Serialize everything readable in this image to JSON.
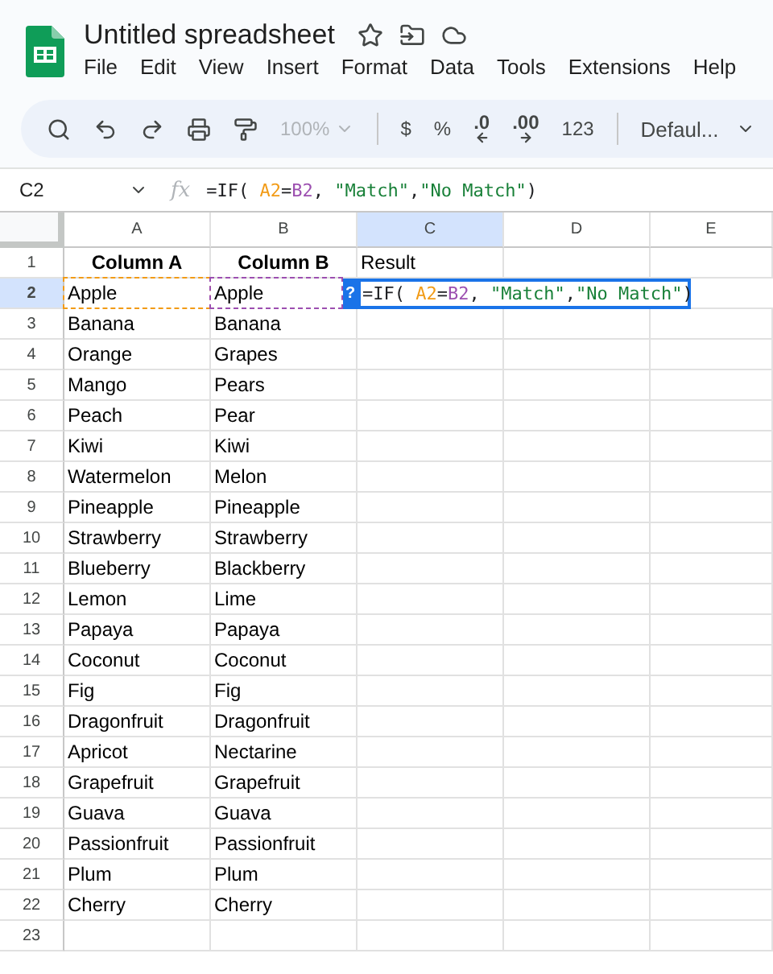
{
  "document": {
    "title": "Untitled spreadsheet"
  },
  "menu": [
    "File",
    "Edit",
    "View",
    "Insert",
    "Format",
    "Data",
    "Tools",
    "Extensions",
    "Help"
  ],
  "toolbar": [
    {
      "kind": "search"
    },
    {
      "kind": "undo"
    },
    {
      "kind": "redo"
    },
    {
      "kind": "print"
    },
    {
      "kind": "paint"
    },
    {
      "kind": "zoom",
      "label": "100%",
      "disabled": true
    },
    {
      "kind": "divider"
    },
    {
      "kind": "text",
      "label": "$"
    },
    {
      "kind": "text",
      "label": "%"
    },
    {
      "kind": "decimal_less",
      "label": ".0"
    },
    {
      "kind": "decimal_more",
      "label": ".00"
    },
    {
      "kind": "text",
      "label": "123"
    },
    {
      "kind": "divider"
    },
    {
      "kind": "font",
      "label": "Defaul..."
    }
  ],
  "formula_bar": {
    "cell_ref": "C2",
    "function_label": "fx",
    "tokens": [
      {
        "text": "=IF( ",
        "color": "#202124"
      },
      {
        "text": "A2",
        "color": "#f29b16"
      },
      {
        "text": "=",
        "color": "#202124"
      },
      {
        "text": "B2",
        "color": "#9c4fb0"
      },
      {
        "text": ", ",
        "color": "#202124"
      },
      {
        "text": "\"Match\"",
        "color": "#188038"
      },
      {
        "text": ",",
        "color": "#202124"
      },
      {
        "text": "\"No Match\"",
        "color": "#188038"
      },
      {
        "text": ")",
        "color": "#202124"
      }
    ]
  },
  "columns": [
    {
      "label": "A",
      "selected": false
    },
    {
      "label": "B",
      "selected": false
    },
    {
      "label": "C",
      "selected": true
    },
    {
      "label": "D",
      "selected": false
    },
    {
      "label": "E",
      "selected": false
    }
  ],
  "rows": [
    {
      "number": "1",
      "selected": false,
      "cells": [
        {
          "text": "Column A",
          "bold": true
        },
        {
          "text": "Column B",
          "bold": true
        },
        {
          "text": "Result",
          "bold": false
        }
      ]
    },
    {
      "number": "2",
      "selected": true,
      "cells": [
        {
          "text": "Apple",
          "color": "#f29b16"
        },
        {
          "text": "Apple",
          "color": "#9c4fb0"
        }
      ],
      "editor": {
        "help": "?",
        "tokens": [
          {
            "text": "=IF( ",
            "color": "#202124"
          },
          {
            "text": "A2",
            "color": "#f29b16"
          },
          {
            "text": "=",
            "color": "#202124"
          },
          {
            "text": "B2",
            "color": "#9c4fb0"
          },
          {
            "text": ", ",
            "color": "#202124"
          },
          {
            "text": "\"Match\"",
            "color": "#188038"
          },
          {
            "text": ",",
            "color": "#202124"
          },
          {
            "text": "\"No Match\"",
            "color": "#188038"
          },
          {
            "text": ")",
            "color": "#202124"
          }
        ]
      }
    },
    {
      "number": "3",
      "selected": false,
      "cells": [
        "Banana",
        "Banana"
      ]
    },
    {
      "number": "4",
      "selected": false,
      "cells": [
        "Orange",
        "Grapes"
      ]
    },
    {
      "number": "5",
      "selected": false,
      "cells": [
        "Mango",
        "Pears"
      ]
    },
    {
      "number": "6",
      "selected": false,
      "cells": [
        "Peach",
        "Pear"
      ]
    },
    {
      "number": "7",
      "selected": false,
      "cells": [
        "Kiwi",
        "Kiwi"
      ]
    },
    {
      "number": "8",
      "selected": false,
      "cells": [
        "Watermelon",
        "Melon"
      ]
    },
    {
      "number": "9",
      "selected": false,
      "cells": [
        "Pineapple",
        "Pineapple"
      ]
    },
    {
      "number": "10",
      "selected": false,
      "cells": [
        "Strawberry",
        "Strawberry"
      ]
    },
    {
      "number": "11",
      "selected": false,
      "cells": [
        "Blueberry",
        "Blackberry"
      ]
    },
    {
      "number": "12",
      "selected": false,
      "cells": [
        "Lemon",
        "Lime"
      ]
    },
    {
      "number": "13",
      "selected": false,
      "cells": [
        "Papaya",
        "Papaya"
      ]
    },
    {
      "number": "14",
      "selected": false,
      "cells": [
        "Coconut",
        "Coconut"
      ]
    },
    {
      "number": "15",
      "selected": false,
      "cells": [
        "Fig",
        "Fig"
      ]
    },
    {
      "number": "16",
      "selected": false,
      "cells": [
        "Dragonfruit",
        "Dragonfruit"
      ]
    },
    {
      "number": "17",
      "selected": false,
      "cells": [
        "Apricot",
        "Nectarine"
      ]
    },
    {
      "number": "18",
      "selected": false,
      "cells": [
        "Grapefruit",
        "Grapefruit"
      ]
    },
    {
      "number": "19",
      "selected": false,
      "cells": [
        "Guava",
        "Guava"
      ]
    },
    {
      "number": "20",
      "selected": false,
      "cells": [
        "Passionfruit",
        "Passionfruit"
      ]
    },
    {
      "number": "21",
      "selected": false,
      "cells": [
        "Plum",
        "Plum"
      ]
    },
    {
      "number": "22",
      "selected": false,
      "cells": [
        "Cherry",
        "Cherry"
      ]
    },
    {
      "number": "23",
      "selected": false,
      "cells": []
    }
  ]
}
